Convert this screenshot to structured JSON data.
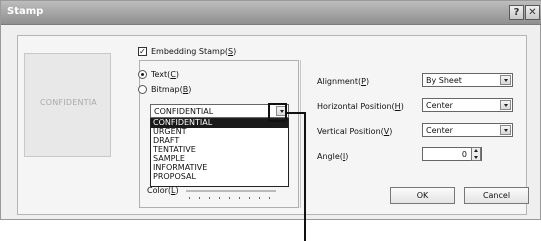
{
  "window": {
    "title": "Stamp",
    "help_glyph": "?",
    "close_glyph": "✕"
  },
  "preview": {
    "text": "CONFIDENTIA"
  },
  "embedding": {
    "checked": true,
    "label": "Embedding Stamp(",
    "key": "S",
    "suffix": ")"
  },
  "type": {
    "text": {
      "label": "Text(",
      "key": "C",
      "suffix": ")",
      "selected": true
    },
    "bitmap": {
      "label": "Bitmap(",
      "key": "B",
      "suffix": ")",
      "selected": false
    }
  },
  "stamp_combo": {
    "value": "CONFIDENTIAL",
    "options": [
      "CONFIDENTIAL",
      "URGENT",
      "DRAFT",
      "TENTATIVE",
      "SAMPLE",
      "INFORMATIVE",
      "PROPOSAL"
    ],
    "selected_index": 0
  },
  "color": {
    "label": "Color(",
    "key": "L",
    "suffix": ")"
  },
  "alignment": {
    "label": "Alignment(",
    "key": "P",
    "suffix": ")",
    "value": "By Sheet"
  },
  "horizontal": {
    "label": "Horizontal Position(",
    "key": "H",
    "suffix": ")",
    "value": "Center"
  },
  "vertical": {
    "label": "Vertical Position(",
    "key": "V",
    "suffix": ")",
    "value": "Center"
  },
  "angle": {
    "label": "Angle(",
    "key": "I",
    "suffix": ")",
    "value": "0"
  },
  "buttons": {
    "ok": "OK",
    "cancel": "Cancel"
  },
  "colors": {
    "title_bar": "#9e9e9e",
    "dropdown_selected": "#1a1a1a"
  }
}
